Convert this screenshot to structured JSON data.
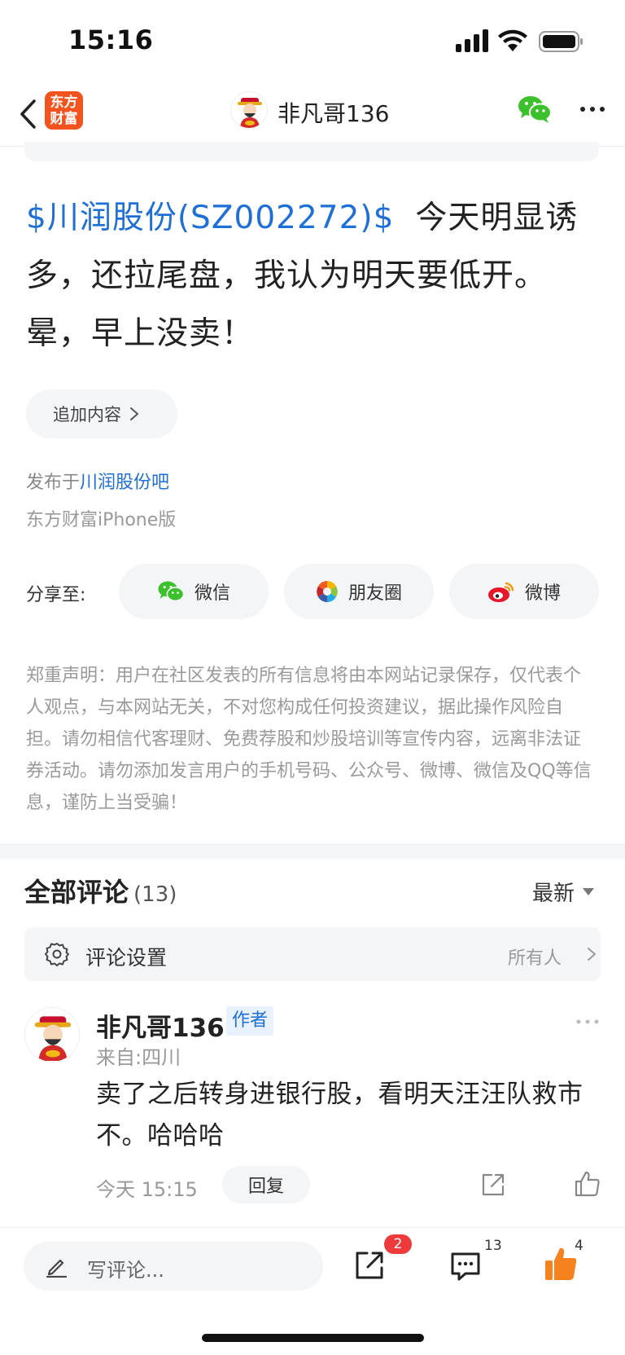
{
  "status_bar": {
    "time": "15:16"
  },
  "nav": {
    "app_logo_line1": "东方",
    "app_logo_line2": "财富",
    "title": "非凡哥136"
  },
  "post": {
    "stock_tag": "$川润股份(SZ002272)$",
    "body": "今天明显诱多，还拉尾盘，我认为明天要低开。晕，早上没卖！",
    "append_label": "追加内容",
    "published_prefix": "发布于",
    "forum_name": "川润股份吧",
    "source": "东方财富iPhone版"
  },
  "share": {
    "label": "分享至:",
    "wechat": "微信",
    "moments": "朋友圈",
    "weibo": "微博"
  },
  "disclaimer": "郑重声明：用户在社区发表的所有信息将由本网站记录保存，仅代表个人观点，与本网站无关，不对您构成任何投资建议，据此操作风险自担。请勿相信代客理财、免费荐股和炒股培训等宣传内容，远离非法证券活动。请勿添加发言用户的手机号码、公众号、微博、微信及QQ等信息，谨防上当受骗！",
  "comments": {
    "title": "全部评论",
    "count": "(13)",
    "sort": "最新",
    "settings_label": "评论设置",
    "settings_value": "所有人",
    "items": [
      {
        "author": "非凡哥136",
        "badge": "作者",
        "location": "来自:四川",
        "text": "卖了之后转身进银行股，看明天汪汪队救市不。哈哈哈",
        "time": "今天 15:15",
        "reply_label": "回复"
      }
    ]
  },
  "bottom_bar": {
    "input_placeholder": "写评论...",
    "share_badge": "2",
    "comment_count": "13",
    "like_count": "4"
  },
  "colors": {
    "link_blue": "#1f6fd9",
    "brand_orange": "#f2531f",
    "like_orange": "#f5821f",
    "badge_red": "#ee3a3a",
    "wechat_green": "#3cc12c",
    "weibo_red": "#e6162d"
  }
}
